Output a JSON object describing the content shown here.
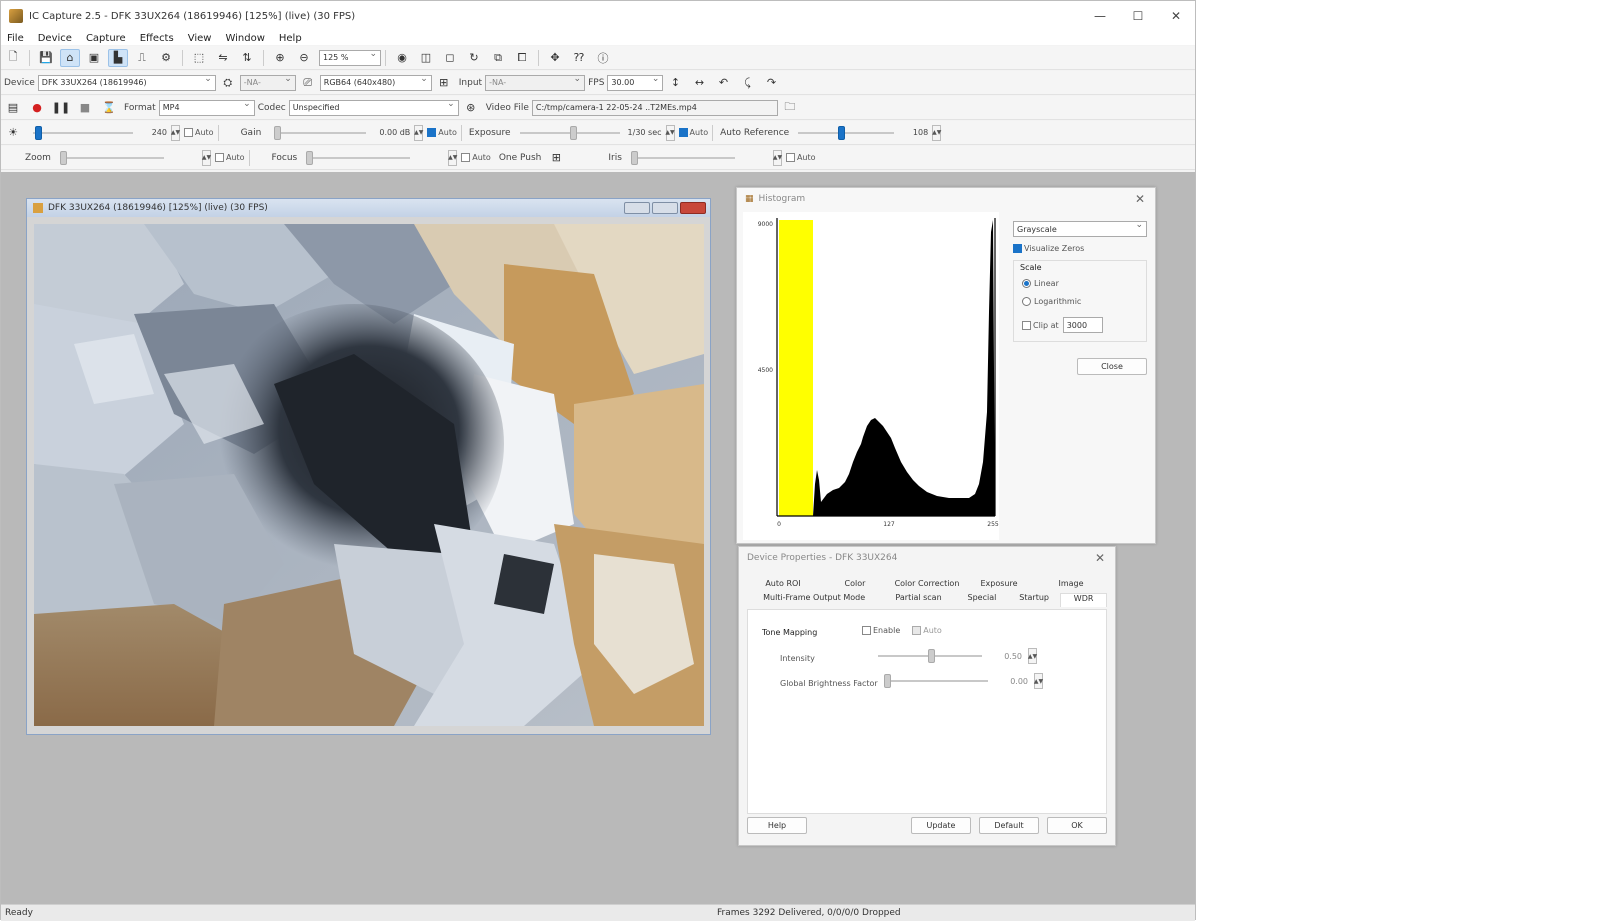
{
  "window": {
    "title": "IC Capture 2.5 - DFK 33UX264 (18619946) [125%] (live) (30 FPS)",
    "minimize": "—",
    "maximize": "☐",
    "close": "✕"
  },
  "menu": [
    "File",
    "Device",
    "Capture",
    "Effects",
    "View",
    "Window",
    "Help"
  ],
  "toolbar": {
    "zoom_value": "125 %"
  },
  "device_row": {
    "device_label": "Device",
    "device_value": "DFK 33UX264 (18619946)",
    "na1": "-NA-",
    "format_value": "RGB64 (640x480)",
    "input_label": "Input",
    "input_value": "-NA-",
    "fps_label": "FPS",
    "fps_value": "30.00"
  },
  "capture_row": {
    "format_label": "Format",
    "format_value": "MP4",
    "codec_label": "Codec",
    "codec_value": "Unspecified",
    "videofile_label": "Video File",
    "videofile_value": "C:/tmp/camera-1 22-05-24 ..T2MEs.mp4"
  },
  "props_row1": {
    "brightness_value": "240",
    "brightness_auto": "Auto",
    "gain_label": "Gain",
    "gain_value": "0.00 dB",
    "gain_auto": "Auto",
    "exposure_label": "Exposure",
    "exposure_value": "1/30 sec",
    "exposure_auto": "Auto",
    "autoref_label": "Auto Reference",
    "autoref_value": "108"
  },
  "props_row2": {
    "zoom_label": "Zoom",
    "zoom_auto": "Auto",
    "focus_label": "Focus",
    "focus_auto": "Auto",
    "onepush_label": "One Push",
    "iris_label": "Iris",
    "iris_auto": "Auto"
  },
  "video_window": {
    "title": "DFK 33UX264 (18619946) [125%] (live) (30 FPS)"
  },
  "histogram": {
    "title": "Histogram",
    "mode": "Grayscale",
    "visualize_zeros": "Visualize Zeros",
    "scale_label": "Scale",
    "linear": "Linear",
    "logarithmic": "Logarithmic",
    "clip_label": "Clip at",
    "clip_value": "3000",
    "close_button": "Close",
    "y_ticks": [
      "9000",
      "4500"
    ],
    "x_ticks": [
      "0",
      "127",
      "255"
    ]
  },
  "device_properties": {
    "title": "Device Properties - DFK 33UX264",
    "tabs_row1": [
      "Auto ROI",
      "Color",
      "Color Correction",
      "Exposure",
      "Image"
    ],
    "tabs_row2": [
      "Multi-Frame Output Mode",
      "Partial scan",
      "Special",
      "Startup",
      "WDR"
    ],
    "tone_mapping": "Tone Mapping",
    "enable": "Enable",
    "auto": "Auto",
    "intensity_label": "Intensity",
    "intensity_value": "0.50",
    "gbf_label": "Global Brightness Factor",
    "gbf_value": "0.00",
    "help_button": "Help",
    "update_button": "Update",
    "default_button": "Default",
    "ok_button": "OK"
  },
  "status": {
    "left": "Ready",
    "frames": "Frames 3292 Delivered, 0/0/0/0 Dropped"
  },
  "colors": {
    "accent": "#1a73c8",
    "histogram_highlight": "#ffff00"
  }
}
